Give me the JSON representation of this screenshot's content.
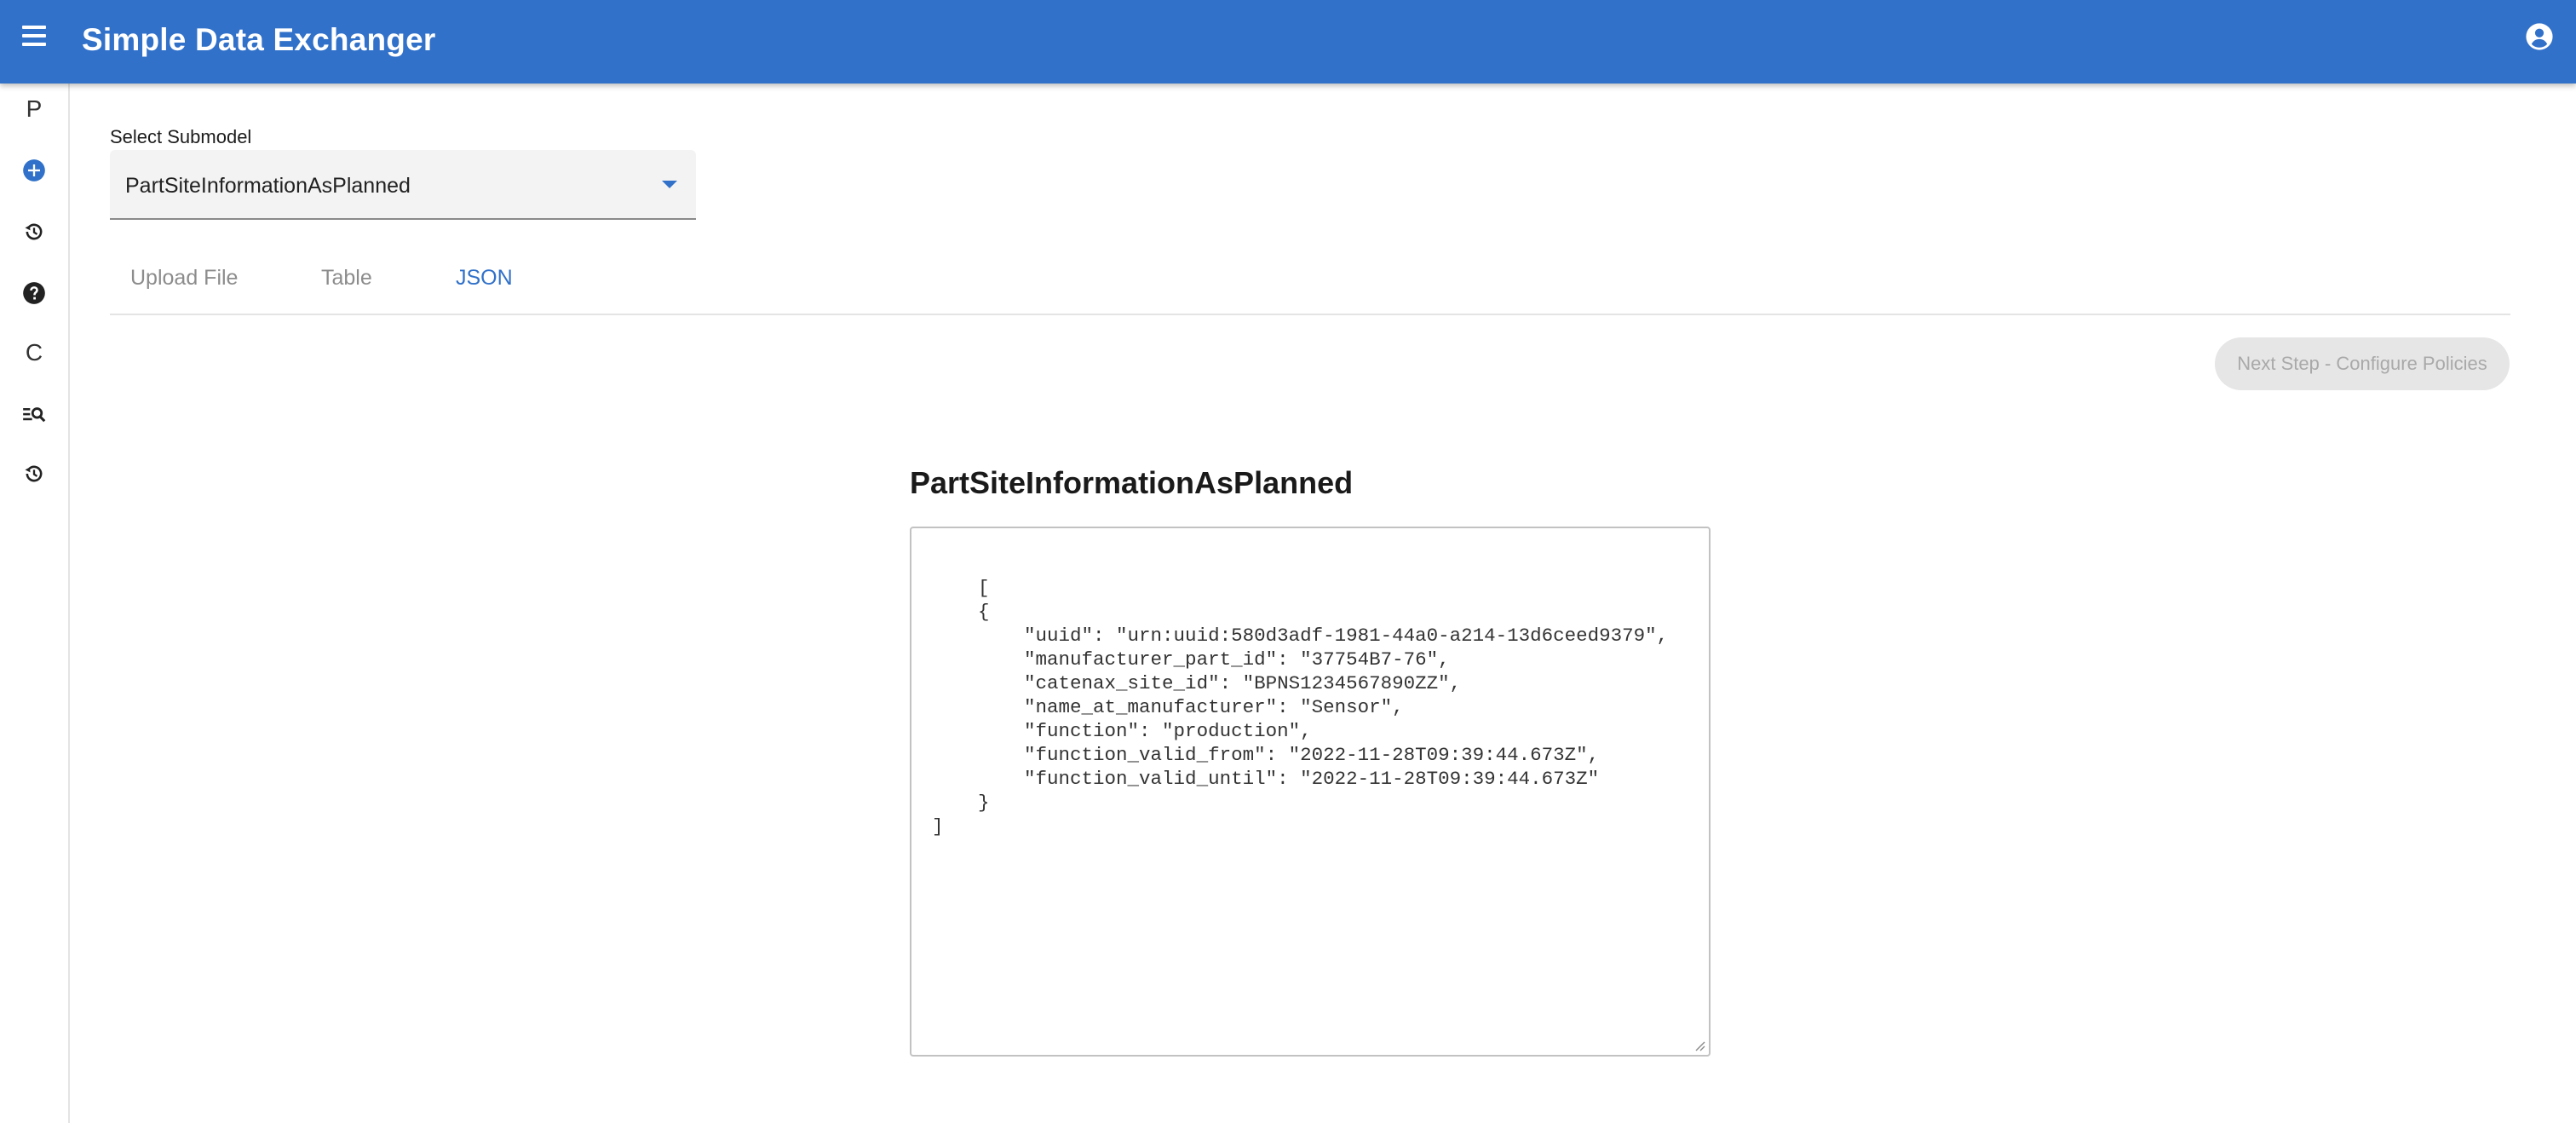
{
  "app": {
    "title": "Simple Data Exchanger"
  },
  "sidebar": {
    "items": [
      {
        "label": "P",
        "icon": "letter-p"
      },
      {
        "icon": "add-circle-icon"
      },
      {
        "icon": "history-icon"
      },
      {
        "icon": "help-icon"
      },
      {
        "label": "C",
        "icon": "letter-c"
      },
      {
        "icon": "manage-search-icon"
      },
      {
        "icon": "history-icon"
      }
    ]
  },
  "submodel": {
    "label": "Select Submodel",
    "value": "PartSiteInformationAsPlanned"
  },
  "tabs": [
    {
      "label": "Upload File",
      "active": false
    },
    {
      "label": "Table",
      "active": false
    },
    {
      "label": "JSON",
      "active": true
    }
  ],
  "next_button": {
    "label": "Next Step - Configure Policies",
    "disabled": true
  },
  "json_view": {
    "title": "PartSiteInformationAsPlanned",
    "content": "[\n    {\n        \"uuid\": \"urn:uuid:580d3adf-1981-44a0-a214-13d6ceed9379\",\n        \"manufacturer_part_id\": \"37754B7-76\",\n        \"catenax_site_id\": \"BPNS1234567890ZZ\",\n        \"name_at_manufacturer\": \"Sensor\",\n        \"function\": \"production\",\n        \"function_valid_from\": \"2022-11-28T09:39:44.673Z\",\n        \"function_valid_until\": \"2022-11-28T09:39:44.673Z\"\n    }\n]"
  },
  "colors": {
    "primary": "#3171c9",
    "disabled_bg": "#e6e6e6",
    "disabled_text": "#a9a9a9"
  }
}
